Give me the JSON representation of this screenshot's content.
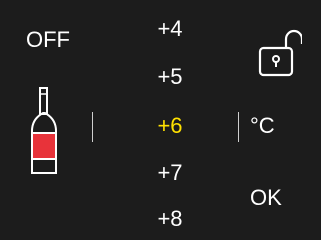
{
  "controls": {
    "off_label": "OFF",
    "ok_label": "OK",
    "unit_label": "°C"
  },
  "temperatures": {
    "items": [
      "+4",
      "+5",
      "+6",
      "+7",
      "+8"
    ],
    "selected": "+6"
  },
  "icons": {
    "lock": "unlocked-padlock-icon",
    "bottle": "wine-bottle-icon"
  },
  "colors": {
    "background": "#1c1c1c",
    "text": "#ffffff",
    "selected": "#ffe100",
    "bottle_fill": "#e8333a"
  }
}
